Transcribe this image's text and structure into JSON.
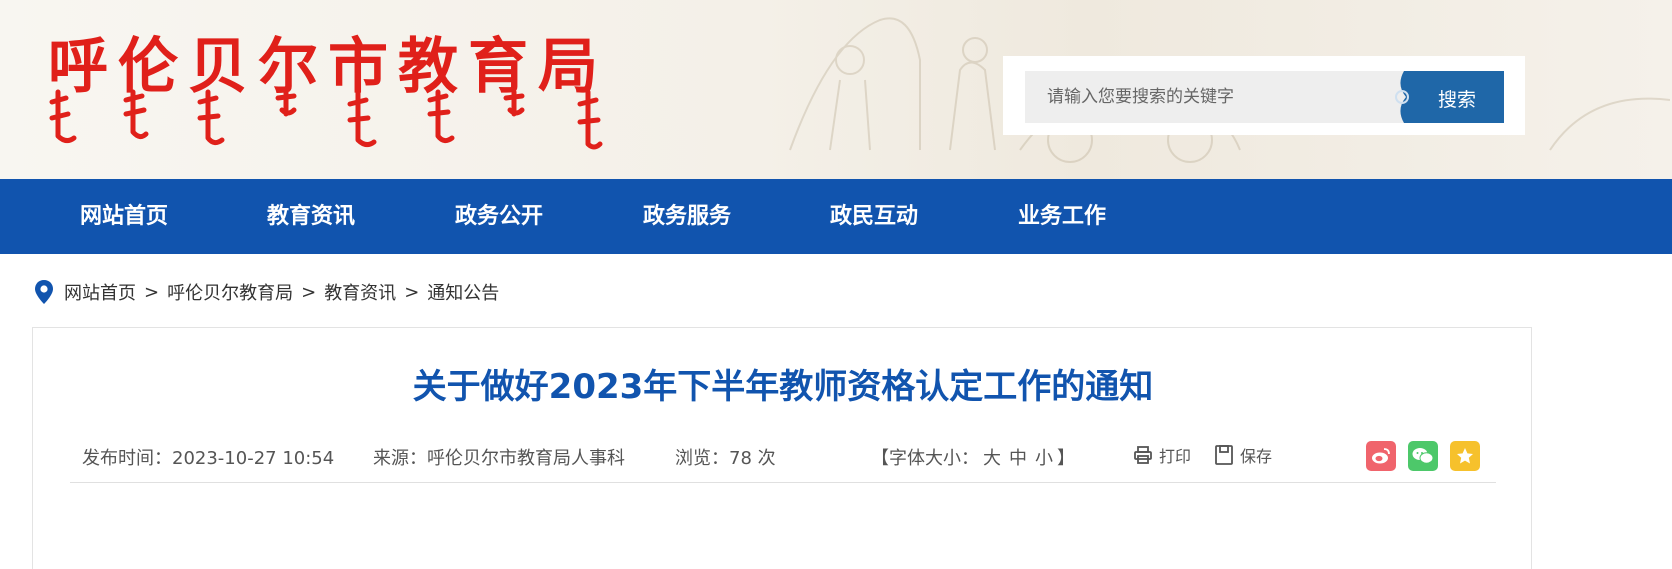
{
  "header": {
    "site_title": "呼伦贝尔市教育局",
    "search": {
      "placeholder": "请输入您要搜索的关键字",
      "value": "",
      "button_label": "搜索"
    }
  },
  "nav": {
    "items": [
      {
        "label": "网站首页"
      },
      {
        "label": "教育资讯"
      },
      {
        "label": "政务公开"
      },
      {
        "label": "政务服务"
      },
      {
        "label": "政民互动"
      },
      {
        "label": "业务工作"
      }
    ]
  },
  "breadcrumb": {
    "icon": "location-pin-icon",
    "items": [
      "网站首页",
      "呼伦贝尔教育局",
      "教育资讯",
      "通知公告"
    ],
    "separator": ">"
  },
  "article": {
    "title": "关于做好2023年下半年教师资格认定工作的通知",
    "publish_time": "发布时间：2023-10-27 10:54",
    "source": "来源：呼伦贝尔市教育局人事科",
    "views_label": "浏览：",
    "views_count": "78",
    "views_unit": "次",
    "font_size_prefix": "【字体大小：",
    "font_size_options": [
      "大",
      "中",
      "小"
    ],
    "font_size_suffix": "】",
    "print_label": "打印",
    "save_label": "保存"
  },
  "share": [
    {
      "name": "weibo",
      "icon": "weibo-icon",
      "color": "#f0646c"
    },
    {
      "name": "wechat",
      "icon": "wechat-icon",
      "color": "#4dc86a"
    },
    {
      "name": "favorite",
      "icon": "star-icon",
      "color": "#f6c12c"
    }
  ],
  "colors": {
    "brand_blue": "#1154ae",
    "title_red": "#e0201a",
    "search_button": "#1f67a8"
  }
}
